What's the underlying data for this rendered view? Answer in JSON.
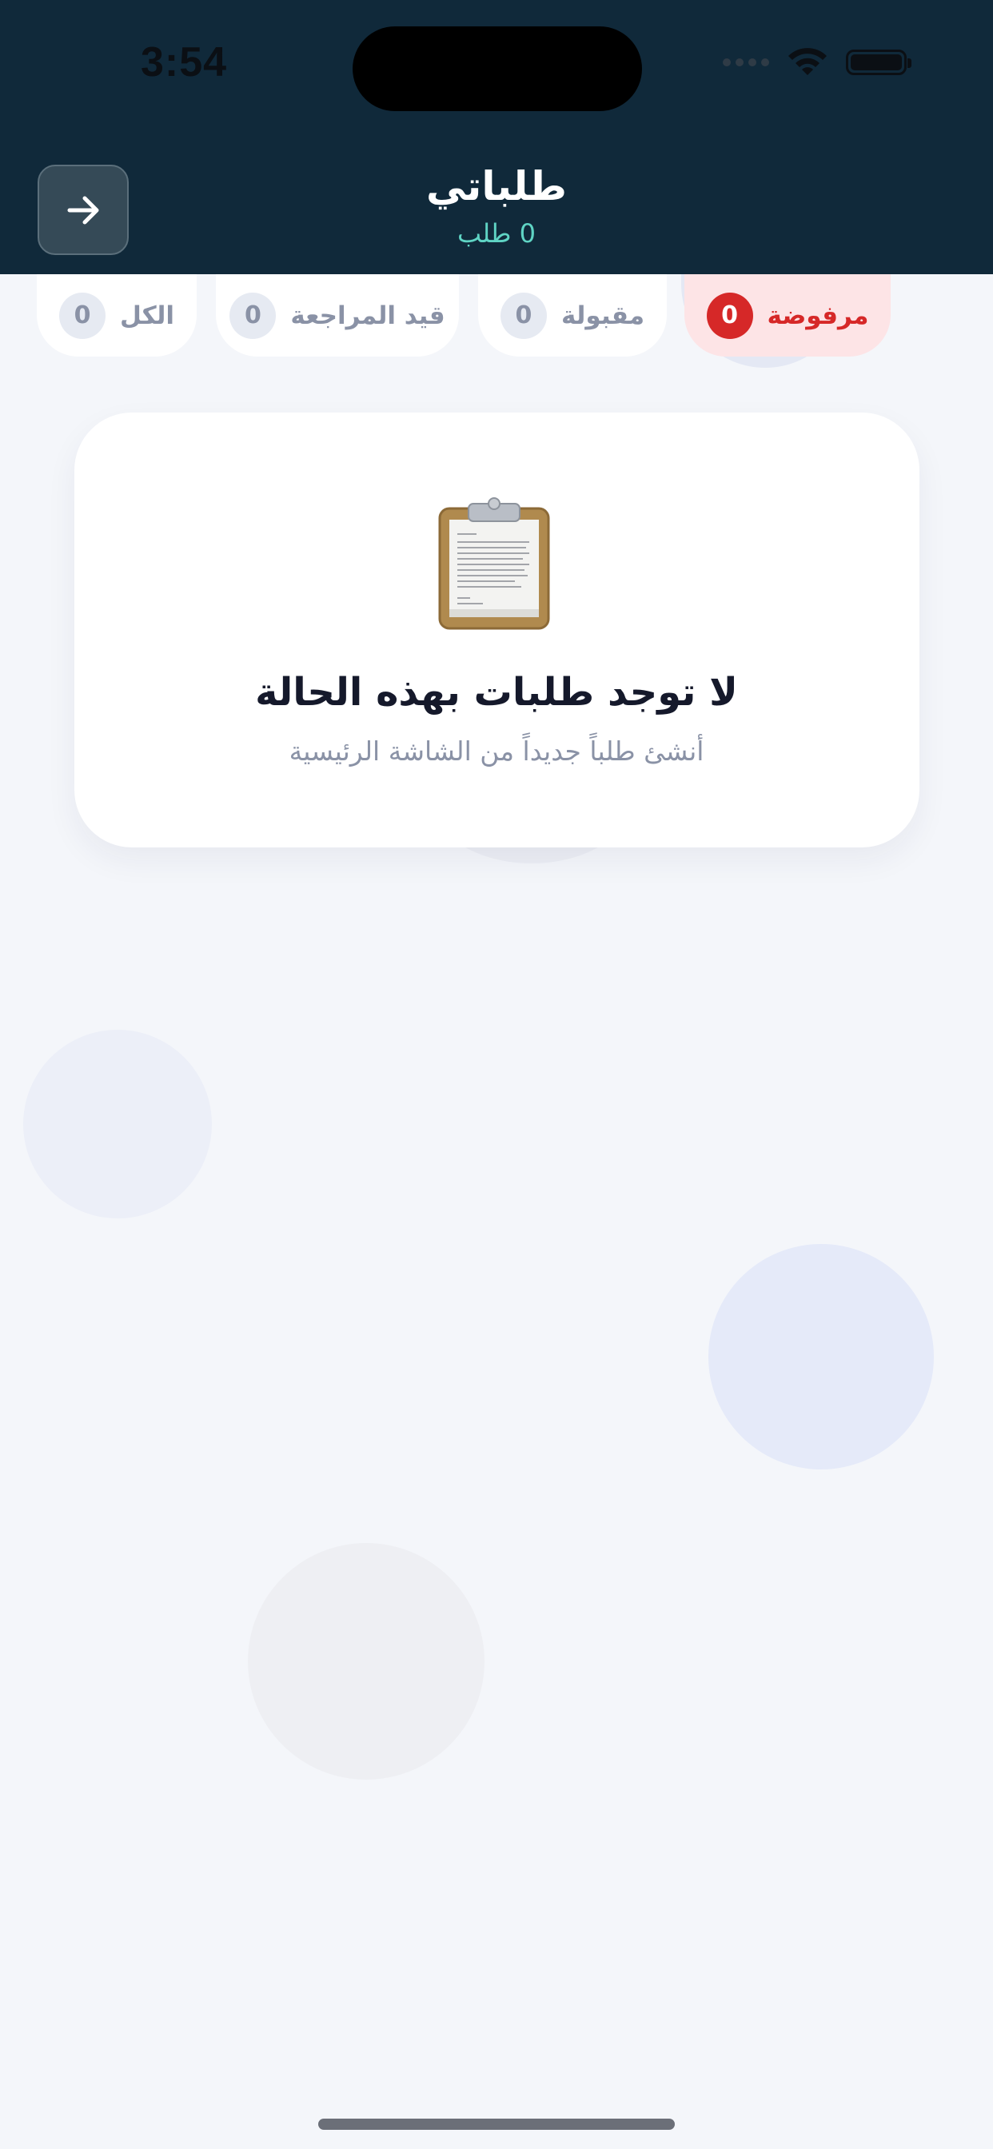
{
  "status_bar": {
    "time": "3:54",
    "icons": [
      "signal-icon",
      "wifi-icon",
      "battery-icon"
    ]
  },
  "header": {
    "title": "طلباتي",
    "subtitle": "0 طلب",
    "back_icon": "arrow-right-icon",
    "background_color": "#10293a",
    "subtitle_color": "#5fd4c4"
  },
  "filters": {
    "active": "rejected",
    "tabs": [
      {
        "key": "rejected",
        "label": "مرفوضة",
        "count": "0"
      },
      {
        "key": "accepted",
        "label": "مقبولة",
        "count": "0"
      },
      {
        "key": "pending",
        "label": "قيد المراجعة",
        "count": "0"
      },
      {
        "key": "all",
        "label": "الكل",
        "count": "0"
      }
    ],
    "active_color": "#d62828"
  },
  "empty_state": {
    "icon": "clipboard-icon",
    "title": "لا توجد طلبات بهذه الحالة",
    "subtitle": "أنشئ طلباً جديداً من الشاشة الرئيسية"
  }
}
